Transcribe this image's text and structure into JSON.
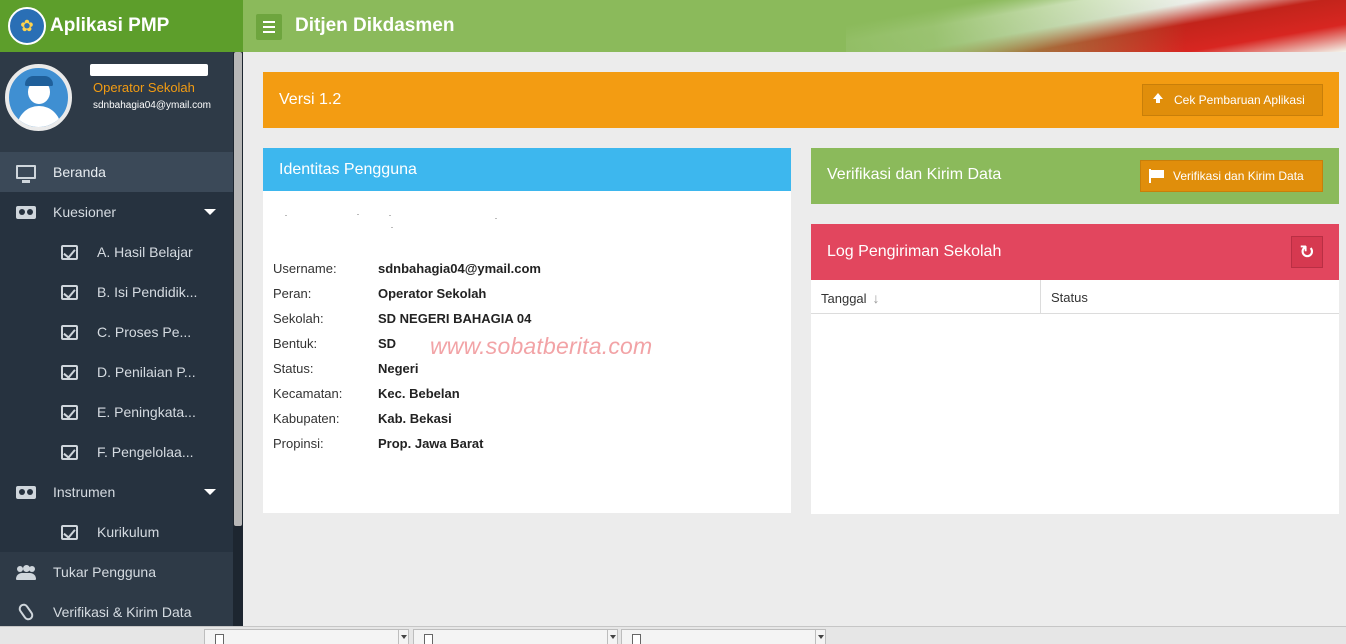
{
  "app": {
    "brand_title": "Aplikasi PMP",
    "header_title": "Ditjen Dikdasmen"
  },
  "user": {
    "role": "Operator Sekolah",
    "email": "sdnbahagia04@ymail.com"
  },
  "sidebar": {
    "items": [
      {
        "label": "Beranda",
        "icon": "monitor-icon",
        "active": true
      },
      {
        "label": "Kuesioner",
        "icon": "clipboard-icon",
        "expandable": true
      },
      {
        "label": "A. Hasil Belajar",
        "icon": "check-square-icon",
        "sub": true
      },
      {
        "label": "B. Isi Pendidik...",
        "icon": "check-square-icon",
        "sub": true
      },
      {
        "label": "C. Proses Pe...",
        "icon": "check-square-icon",
        "sub": true
      },
      {
        "label": "D. Penilaian P...",
        "icon": "check-square-icon",
        "sub": true
      },
      {
        "label": "E. Peningkata...",
        "icon": "check-square-icon",
        "sub": true
      },
      {
        "label": "F. Pengelolaa...",
        "icon": "check-square-icon",
        "sub": true
      },
      {
        "label": "Instrumen",
        "icon": "clipboard-icon",
        "expandable": true
      },
      {
        "label": "Kurikulum",
        "icon": "check-square-icon",
        "sub": true
      },
      {
        "label": "Tukar Pengguna",
        "icon": "users-icon"
      },
      {
        "label": "Verifikasi & Kirim Data",
        "icon": "paperclip-icon"
      }
    ]
  },
  "version_bar": {
    "text": "Versi 1.2",
    "button_label": "Cek Pembaruan Aplikasi"
  },
  "identity": {
    "title": "Identitas Pengguna",
    "rows": [
      {
        "key": "Username:",
        "value": "sdnbahagia04@ymail.com"
      },
      {
        "key": "Peran:",
        "value": "Operator Sekolah"
      },
      {
        "key": "Sekolah:",
        "value": "SD NEGERI BAHAGIA 04"
      },
      {
        "key": "Bentuk:",
        "value": "SD"
      },
      {
        "key": "Status:",
        "value": "Negeri"
      },
      {
        "key": "Kecamatan:",
        "value": "Kec. Bebelan"
      },
      {
        "key": "Kabupaten:",
        "value": "Kab. Bekasi"
      },
      {
        "key": "Propinsi:",
        "value": "Prop. Jawa Barat"
      }
    ],
    "watermark": "www.sobatberita.com"
  },
  "verification": {
    "title": "Verifikasi dan Kirim Data",
    "button_label": "Verifikasi dan Kirim Data"
  },
  "log": {
    "title": "Log Pengiriman Sekolah",
    "columns": [
      "Tanggal",
      "Status"
    ]
  },
  "colors": {
    "brand_green": "#5d9e2b",
    "header_green": "#8bba5b",
    "sidebar_bg": "#26323f",
    "orange": "#f39c12",
    "blue": "#3db7ee",
    "red": "#e2465e"
  }
}
